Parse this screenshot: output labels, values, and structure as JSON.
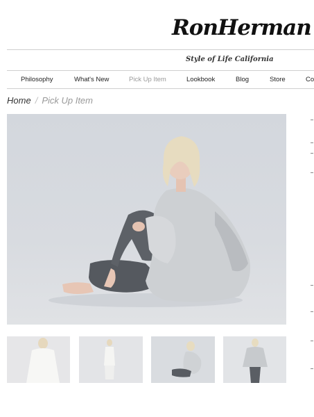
{
  "header": {
    "logo_text": "RonHerman",
    "tagline": "Style of Life California"
  },
  "nav": {
    "items": [
      {
        "label": "Philosophy"
      },
      {
        "label": "What's New"
      },
      {
        "label": "Pick Up Item",
        "active": true
      },
      {
        "label": "Lookbook"
      },
      {
        "label": "Blog"
      },
      {
        "label": "Store"
      },
      {
        "label": "Co"
      }
    ]
  },
  "breadcrumb": {
    "home": "Home",
    "separator": "/",
    "current": "Pick Up Item"
  },
  "gallery": {
    "main_image": "model-sitting-grey-knit-hoodie",
    "thumbnails": [
      {
        "name": "thumbnail-white-knit-front"
      },
      {
        "name": "thumbnail-white-outfit-full-length"
      },
      {
        "name": "thumbnail-sitting-pose"
      },
      {
        "name": "thumbnail-grey-hoodie-standing"
      }
    ]
  },
  "colors": {
    "background": "#ffffff",
    "nav_active": "#9a9a9a",
    "photo_backdrop": "#d6d9de"
  }
}
